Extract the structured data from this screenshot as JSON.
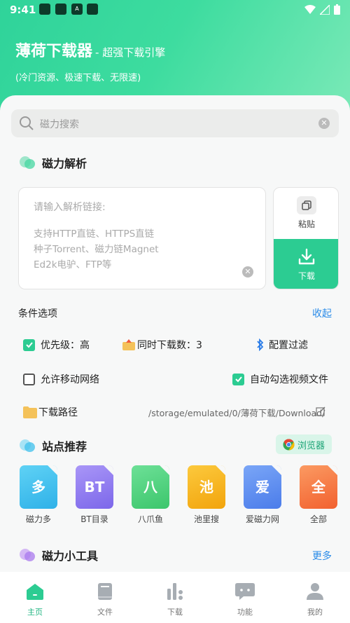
{
  "status": {
    "time": "9:41",
    "notif_badge": "A"
  },
  "header": {
    "title": "薄荷下载器",
    "subtitle": "- 超强下载引擎",
    "desc": "(冷门资源、极速下载、无限速)"
  },
  "search": {
    "placeholder": "磁力搜索"
  },
  "parse": {
    "title": "磁力解析",
    "input_placeholder": "请输入解析链接:",
    "hints": [
      "支持HTTP直链、HTTPS直链",
      "种子Torrent、磁力链Magnet",
      "Ed2k电驴、FTP等"
    ],
    "paste_label": "粘贴",
    "download_label": "下载"
  },
  "options": {
    "title": "条件选项",
    "collapse": "收起",
    "priority": "优先级：高",
    "concurrent": "同时下载数：3",
    "filter": "配置过滤",
    "mobile_network": "允许移动网络",
    "mobile_network_checked": false,
    "auto_video": "自动勾选视频文件",
    "auto_video_checked": true,
    "priority_checked": true,
    "path_label": "下载路径",
    "path_value": "/storage/emulated/0/薄荷下载/Download/"
  },
  "sites": {
    "title": "站点推荐",
    "browser": "浏览器",
    "items": [
      {
        "glyph": "多",
        "name": "磁力多",
        "color": "#3cc1ee"
      },
      {
        "glyph": "BT",
        "name": "BT目录",
        "color": "#8f7cf0"
      },
      {
        "glyph": "八",
        "name": "八爪鱼",
        "color": "#4fd27a"
      },
      {
        "glyph": "池",
        "name": "池里搜",
        "color": "#f6b41a"
      },
      {
        "glyph": "爱",
        "name": "爱磁力网",
        "color": "#5d8ef0"
      },
      {
        "glyph": "全",
        "name": "全部",
        "color": "#f57a47"
      }
    ]
  },
  "tools": {
    "title": "磁力小工具",
    "more": "更多"
  },
  "tabs": [
    {
      "label": "主页",
      "icon": "home-icon",
      "active": true
    },
    {
      "label": "文件",
      "icon": "book-icon",
      "active": false
    },
    {
      "label": "下载",
      "icon": "bars-icon",
      "active": false
    },
    {
      "label": "功能",
      "icon": "chat-icon",
      "active": false
    },
    {
      "label": "我的",
      "icon": "user-icon",
      "active": false
    }
  ],
  "colors": {
    "accent": "#2ccc92",
    "link": "#2a8be8"
  }
}
